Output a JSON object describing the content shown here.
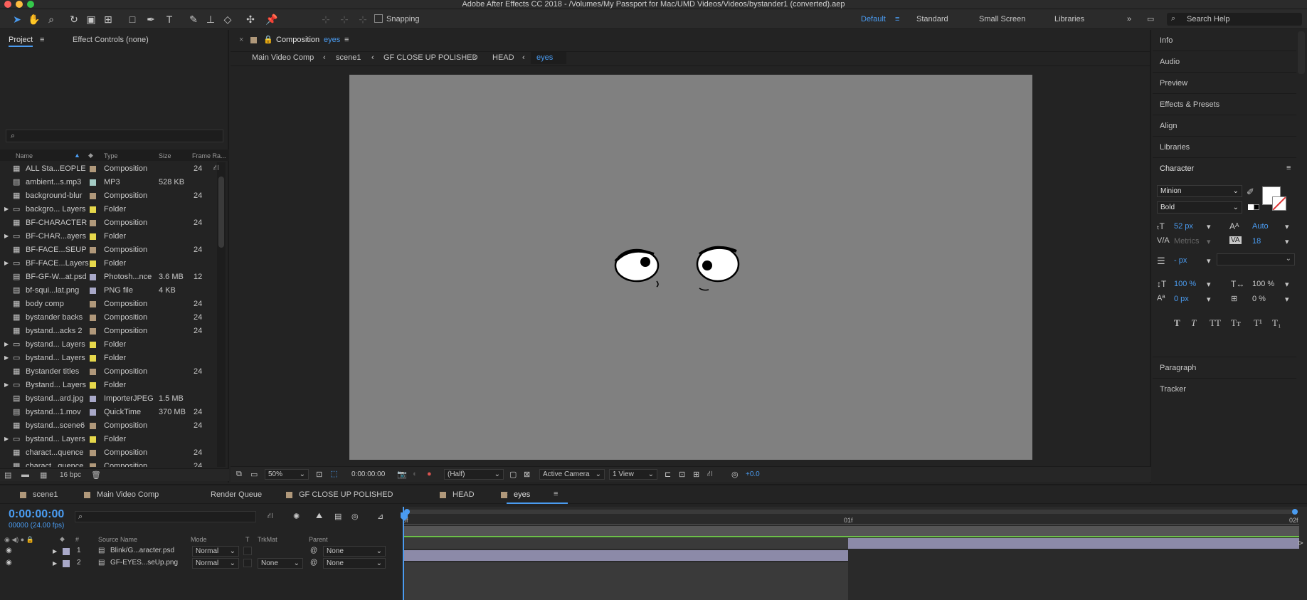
{
  "window": {
    "title": "Adobe After Effects CC 2018 - /Volumes/My Passport for Mac/UMD Videos/Videos/bystander1 (converted).aep"
  },
  "toolbar": {
    "snapping_label": "Snapping",
    "workspaces": [
      "Default",
      "Standard",
      "Small Screen",
      "Libraries"
    ],
    "search_placeholder": "Search Help"
  },
  "project": {
    "tab_project": "Project",
    "tab_effect_controls": "Effect Controls (none)",
    "columns": {
      "name": "Name",
      "type": "Type",
      "size": "Size",
      "frame_rate": "Frame Ra..."
    },
    "items": [
      {
        "icon": "composition-icon",
        "name": "ALL Sta...EOPLE",
        "color": "#b0987a",
        "type": "Composition",
        "size": "",
        "fps": "24",
        "folder": false
      },
      {
        "icon": "audio-file-icon",
        "name": "ambient...s.mp3",
        "color": "#a3cbc4",
        "type": "MP3",
        "size": "528 KB",
        "fps": "",
        "folder": false
      },
      {
        "icon": "composition-icon",
        "name": "background-blur",
        "color": "#b0987a",
        "type": "Composition",
        "size": "",
        "fps": "24",
        "folder": false
      },
      {
        "icon": "folder-icon",
        "name": "backgro... Layers",
        "color": "#e6d84b",
        "type": "Folder",
        "size": "",
        "fps": "",
        "folder": true
      },
      {
        "icon": "composition-icon",
        "name": "BF-CHARACTER",
        "color": "#b0987a",
        "type": "Composition",
        "size": "",
        "fps": "24",
        "folder": false
      },
      {
        "icon": "folder-icon",
        "name": "BF-CHAR...ayers",
        "color": "#e6d84b",
        "type": "Folder",
        "size": "",
        "fps": "",
        "folder": true
      },
      {
        "icon": "composition-icon",
        "name": "BF-FACE...SEUP",
        "color": "#b0987a",
        "type": "Composition",
        "size": "",
        "fps": "24",
        "folder": false
      },
      {
        "icon": "folder-icon",
        "name": "BF-FACE...Layers",
        "color": "#e6d84b",
        "type": "Folder",
        "size": "",
        "fps": "",
        "folder": true
      },
      {
        "icon": "photoshop-file-icon",
        "name": "BF-GF-W...at.psd",
        "color": "#a8a8c8",
        "type": "Photosh...nce",
        "size": "3.6 MB",
        "fps": "12",
        "folder": false
      },
      {
        "icon": "image-file-icon",
        "name": "bf-squi...lat.png",
        "color": "#a8a8c8",
        "type": "PNG file",
        "size": "4 KB",
        "fps": "",
        "folder": false
      },
      {
        "icon": "composition-icon",
        "name": "body comp",
        "color": "#b0987a",
        "type": "Composition",
        "size": "",
        "fps": "24",
        "folder": false
      },
      {
        "icon": "composition-icon",
        "name": "bystander backs",
        "color": "#b0987a",
        "type": "Composition",
        "size": "",
        "fps": "24",
        "folder": false
      },
      {
        "icon": "composition-icon",
        "name": "bystand...acks 2",
        "color": "#b0987a",
        "type": "Composition",
        "size": "",
        "fps": "24",
        "folder": false
      },
      {
        "icon": "folder-icon",
        "name": "bystand... Layers",
        "color": "#e6d84b",
        "type": "Folder",
        "size": "",
        "fps": "",
        "folder": true
      },
      {
        "icon": "folder-icon",
        "name": "bystand... Layers",
        "color": "#e6d84b",
        "type": "Folder",
        "size": "",
        "fps": "",
        "folder": true
      },
      {
        "icon": "composition-icon",
        "name": "Bystander titles",
        "color": "#b0987a",
        "type": "Composition",
        "size": "",
        "fps": "24",
        "folder": false
      },
      {
        "icon": "folder-icon",
        "name": "Bystand... Layers",
        "color": "#e6d84b",
        "type": "Folder",
        "size": "",
        "fps": "",
        "folder": true
      },
      {
        "icon": "image-file-icon",
        "name": "bystand...ard.jpg",
        "color": "#a8a8c8",
        "type": "ImporterJPEG",
        "size": "1.5 MB",
        "fps": "",
        "folder": false
      },
      {
        "icon": "movie-file-icon",
        "name": "bystand...1.mov",
        "color": "#a8a8c8",
        "type": "QuickTime",
        "size": "370 MB",
        "fps": "24",
        "folder": false
      },
      {
        "icon": "composition-icon",
        "name": "bystand...scene6",
        "color": "#b0987a",
        "type": "Composition",
        "size": "",
        "fps": "24",
        "folder": false
      },
      {
        "icon": "folder-icon",
        "name": "bystand... Layers",
        "color": "#e6d84b",
        "type": "Folder",
        "size": "",
        "fps": "",
        "folder": true
      },
      {
        "icon": "composition-icon",
        "name": "charact...quence",
        "color": "#b0987a",
        "type": "Composition",
        "size": "",
        "fps": "24",
        "folder": false
      },
      {
        "icon": "composition-icon",
        "name": "charact...quence",
        "color": "#b0987a",
        "type": "Composition",
        "size": "",
        "fps": "24",
        "folder": false
      }
    ],
    "footer_bpc": "16 bpc"
  },
  "composition": {
    "tab_label": "Composition",
    "tab_name": "eyes",
    "breadcrumbs": [
      "Main Video Comp",
      "scene1",
      "GF CLOSE UP POLISHED",
      "HEAD",
      "eyes"
    ],
    "zoom": "50%",
    "timecode": "0:00:00:00",
    "resolution": "(Half)",
    "camera": "Active Camera",
    "views": "1 View",
    "exposure": "+0.0"
  },
  "right_panels": [
    "Info",
    "Audio",
    "Preview",
    "Effects & Presets",
    "Align",
    "Libraries"
  ],
  "character": {
    "title": "Character",
    "font": "Minion",
    "style": "Bold",
    "size": "52 px",
    "leading": "Auto",
    "kerning": "Metrics",
    "tracking": "18",
    "stroke": "- px",
    "vscale": "100 %",
    "hscale": "100 %",
    "baseline": "0 px",
    "tsume": "0 %",
    "style_buttons": [
      "T",
      "T",
      "TT",
      "Tт",
      "T¹",
      "T₁"
    ]
  },
  "lower_panels": [
    "Paragraph",
    "Tracker"
  ],
  "timeline": {
    "tabs": [
      "scene1",
      "Main Video Comp",
      "Render Queue",
      "GF CLOSE UP POLISHED",
      "HEAD",
      "eyes"
    ],
    "timecode": "0:00:00:00",
    "fps_readout": "00000 (24.00 fps)",
    "columns": {
      "num": "#",
      "source": "Source Name",
      "mode": "Mode",
      "t": "T",
      "trkmat": "TrkMat",
      "parent": "Parent"
    },
    "ruler": [
      "0f",
      "01f",
      "02f"
    ],
    "layers": [
      {
        "num": "1",
        "name": "Blink/G...aracter.psd",
        "mode": "Normal",
        "trkmat": "",
        "parent": "None"
      },
      {
        "num": "2",
        "name": "GF-EYES...seUp.png",
        "mode": "Normal",
        "trkmat": "None",
        "parent": "None"
      }
    ]
  },
  "colors": {
    "accent": "#4a9bf0",
    "panel": "#232323",
    "canvas": "#808080"
  }
}
